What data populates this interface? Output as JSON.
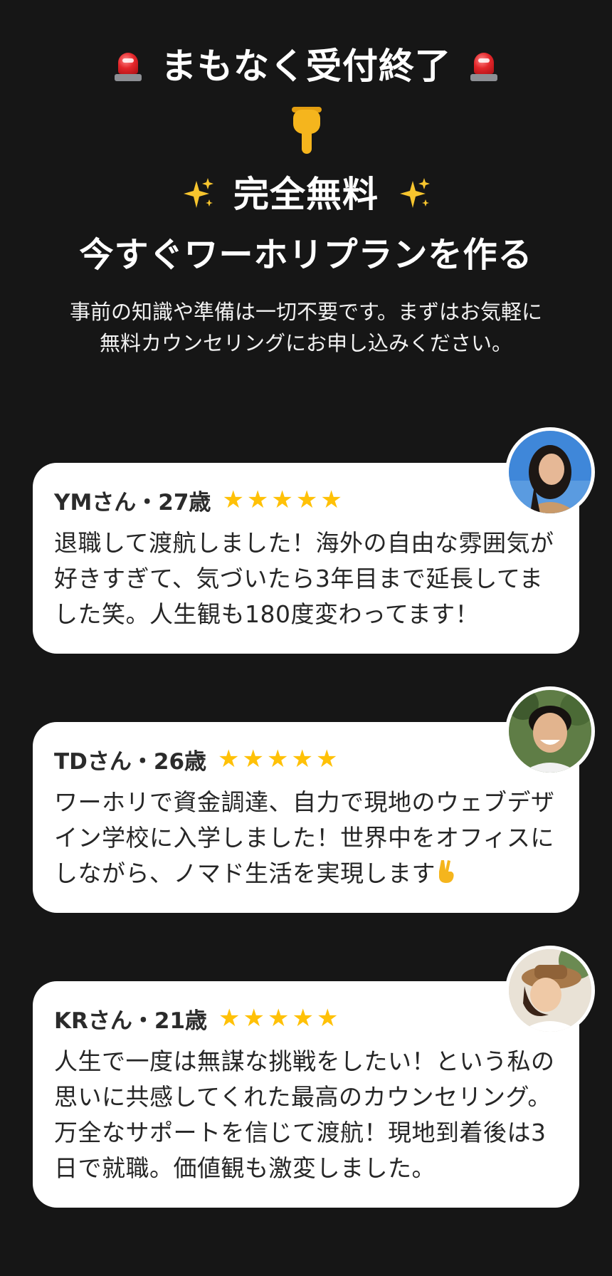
{
  "hero": {
    "urgent_title": "まもなく受付終了",
    "free_label": "完全無料",
    "cta_heading": "今すぐワーホリプランを作る",
    "lead_line1": "事前の知識や準備は一切不要です。まずはお気軽に",
    "lead_line2": "無料カウンセリングにお申し込みください。"
  },
  "icons": {
    "siren": "siren-icon",
    "pointer": "backhand-index-pointing-down-icon",
    "sparkle": "sparkles-icon",
    "star": "star-icon",
    "victory": "victory-hand-icon"
  },
  "colors": {
    "background": "#161616",
    "card": "#ffffff",
    "star": "#ffc107",
    "text_dark": "#262626"
  },
  "reviews": [
    {
      "name": "YMさん・27歳",
      "rating": 5,
      "star_glyph": "★",
      "body": "退職して渡航しました！海外の自由な雰囲気が好きすぎて、気づいたら3年目まで延長してました笑。人生観も180度変わってます！"
    },
    {
      "name": "TDさん・26歳",
      "rating": 5,
      "star_glyph": "★",
      "body": "ワーホリで資金調達、自力で現地のウェブデザイン学校に入学しました！世界中をオフィスにしながら、ノマド生活を実現します"
    },
    {
      "name": "KRさん・21歳",
      "rating": 5,
      "star_glyph": "★",
      "body": "人生で一度は無謀な挑戦をしたい！という私の思いに共感してくれた最高のカウンセリング。万全なサポートを信じて渡航！現地到着後は3日で就職。価値観も激変しました。"
    }
  ]
}
